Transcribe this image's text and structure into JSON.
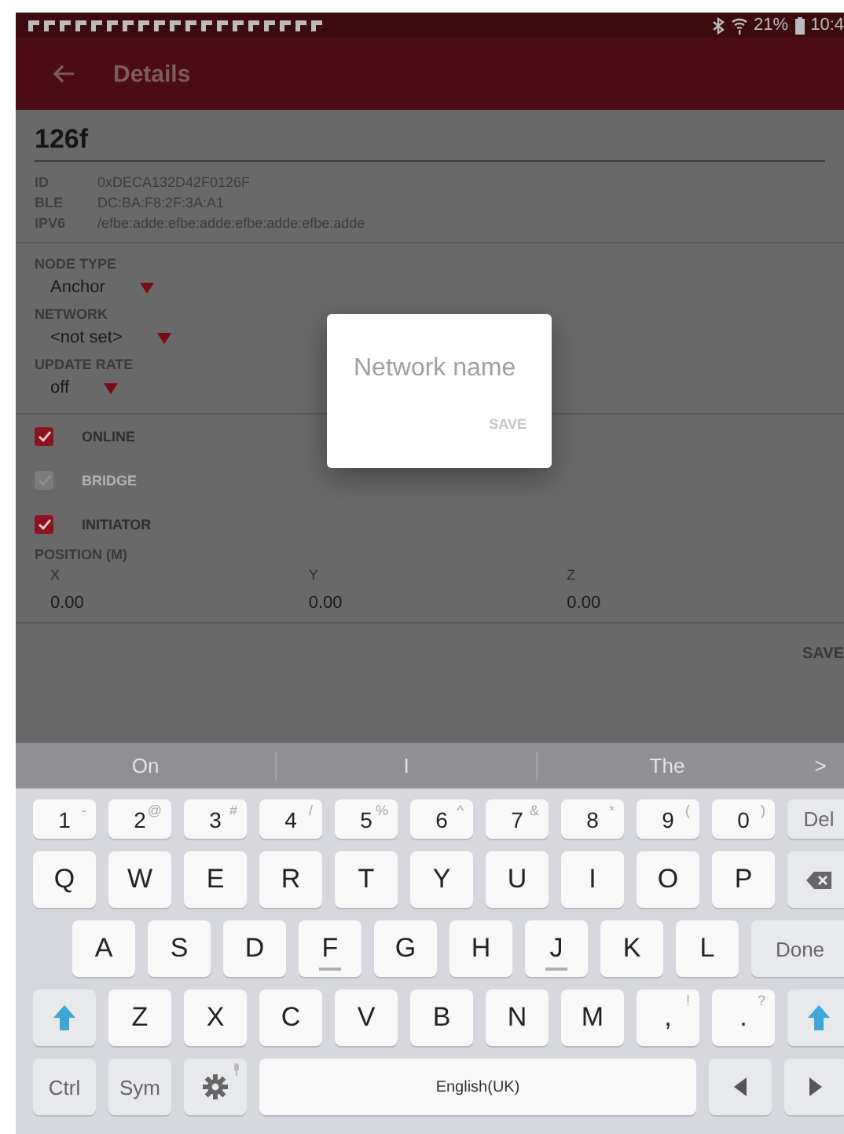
{
  "status_bar": {
    "battery": "21%",
    "time": "10:4"
  },
  "app_bar": {
    "title": "Details"
  },
  "detail": {
    "name": "126f",
    "properties": [
      {
        "label": "ID",
        "value": "0xDECA132D42F0126F"
      },
      {
        "label": "BLE",
        "value": "DC:BA:F8:2F:3A:A1"
      },
      {
        "label": "IPV6",
        "value": "/efbe:adde:efbe:adde:efbe:adde:efbe:adde"
      }
    ],
    "dropdowns": [
      {
        "label": "NODE TYPE",
        "value": "Anchor"
      },
      {
        "label": "NETWORK",
        "value": "<not set>"
      },
      {
        "label": "UPDATE RATE",
        "value": "off"
      }
    ],
    "checkboxes": [
      {
        "label": "ONLINE",
        "checked": true,
        "disabled": false
      },
      {
        "label": "BRIDGE",
        "checked": true,
        "disabled": true
      },
      {
        "label": "INITIATOR",
        "checked": true,
        "disabled": false
      }
    ],
    "position": {
      "label": "POSITION (M)",
      "fields": [
        {
          "label": "X",
          "value": "0.00"
        },
        {
          "label": "Y",
          "value": "0.00"
        },
        {
          "label": "Z",
          "value": "0.00"
        }
      ]
    },
    "save": "SAVE"
  },
  "dialog": {
    "placeholder": "Network name",
    "button": "SAVE"
  },
  "keyboard": {
    "suggestions": [
      "On",
      "I",
      "The"
    ],
    "more": ">",
    "rows": [
      {
        "keys": [
          {
            "kind": "char",
            "label": "1",
            "hint": "-"
          },
          {
            "kind": "char",
            "label": "2",
            "hint": "@"
          },
          {
            "kind": "char",
            "label": "3",
            "hint": "#"
          },
          {
            "kind": "char",
            "label": "4",
            "hint": "/"
          },
          {
            "kind": "char",
            "label": "5",
            "hint": "%"
          },
          {
            "kind": "char",
            "label": "6",
            "hint": "^"
          },
          {
            "kind": "char",
            "label": "7",
            "hint": "&"
          },
          {
            "kind": "char",
            "label": "8",
            "hint": "*"
          },
          {
            "kind": "char",
            "label": "9",
            "hint": "("
          },
          {
            "kind": "char",
            "label": "0",
            "hint": ")"
          },
          {
            "kind": "func",
            "label": "Del"
          }
        ]
      },
      {
        "keys": [
          {
            "kind": "char",
            "label": "Q"
          },
          {
            "kind": "char",
            "label": "W"
          },
          {
            "kind": "char",
            "label": "E"
          },
          {
            "kind": "char",
            "label": "R"
          },
          {
            "kind": "char",
            "label": "T"
          },
          {
            "kind": "char",
            "label": "Y"
          },
          {
            "kind": "char",
            "label": "U"
          },
          {
            "kind": "char",
            "label": "I"
          },
          {
            "kind": "char",
            "label": "O"
          },
          {
            "kind": "char",
            "label": "P"
          },
          {
            "kind": "backspace"
          }
        ]
      },
      {
        "keys": [
          {
            "kind": "char",
            "label": "A"
          },
          {
            "kind": "char",
            "label": "S"
          },
          {
            "kind": "char",
            "label": "D"
          },
          {
            "kind": "char",
            "label": "F",
            "bump": true
          },
          {
            "kind": "char",
            "label": "G"
          },
          {
            "kind": "char",
            "label": "H"
          },
          {
            "kind": "char",
            "label": "J",
            "bump": true
          },
          {
            "kind": "char",
            "label": "K"
          },
          {
            "kind": "char",
            "label": "L"
          },
          {
            "kind": "wide",
            "label": "Done"
          }
        ]
      },
      {
        "keys": [
          {
            "kind": "shift"
          },
          {
            "kind": "char",
            "label": "Z"
          },
          {
            "kind": "char",
            "label": "X"
          },
          {
            "kind": "char",
            "label": "C"
          },
          {
            "kind": "char",
            "label": "V"
          },
          {
            "kind": "char",
            "label": "B"
          },
          {
            "kind": "char",
            "label": "N"
          },
          {
            "kind": "char",
            "label": "M"
          },
          {
            "kind": "char",
            "label": ",",
            "hint": "!"
          },
          {
            "kind": "char",
            "label": ".",
            "hint": "?"
          },
          {
            "kind": "shift"
          }
        ]
      },
      {
        "keys": [
          {
            "kind": "func",
            "label": "Ctrl"
          },
          {
            "kind": "func",
            "label": "Sym"
          },
          {
            "kind": "settings"
          },
          {
            "kind": "space",
            "label": "English(UK)"
          },
          {
            "kind": "left"
          },
          {
            "kind": "right"
          }
        ]
      }
    ]
  }
}
